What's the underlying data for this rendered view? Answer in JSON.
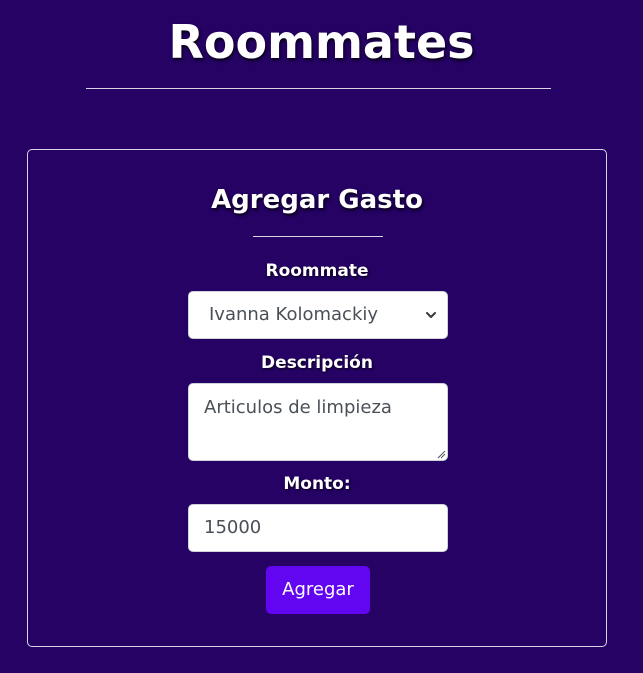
{
  "header": {
    "title": "Roommates"
  },
  "form": {
    "title": "Agregar Gasto",
    "roommate": {
      "label": "Roommate",
      "selected": "Ivanna Kolomackiy",
      "icon": "chevron-down-icon"
    },
    "description": {
      "label": "Descripción",
      "value": "Articulos de limpieza",
      "icon": "resize-grip-icon"
    },
    "amount": {
      "label": "Monto:",
      "value": "15000"
    },
    "submit_label": "Agregar"
  },
  "colors": {
    "background": "#250264",
    "button": "#6205f0",
    "text": "#ffffff",
    "border": "#d8d2e6"
  }
}
